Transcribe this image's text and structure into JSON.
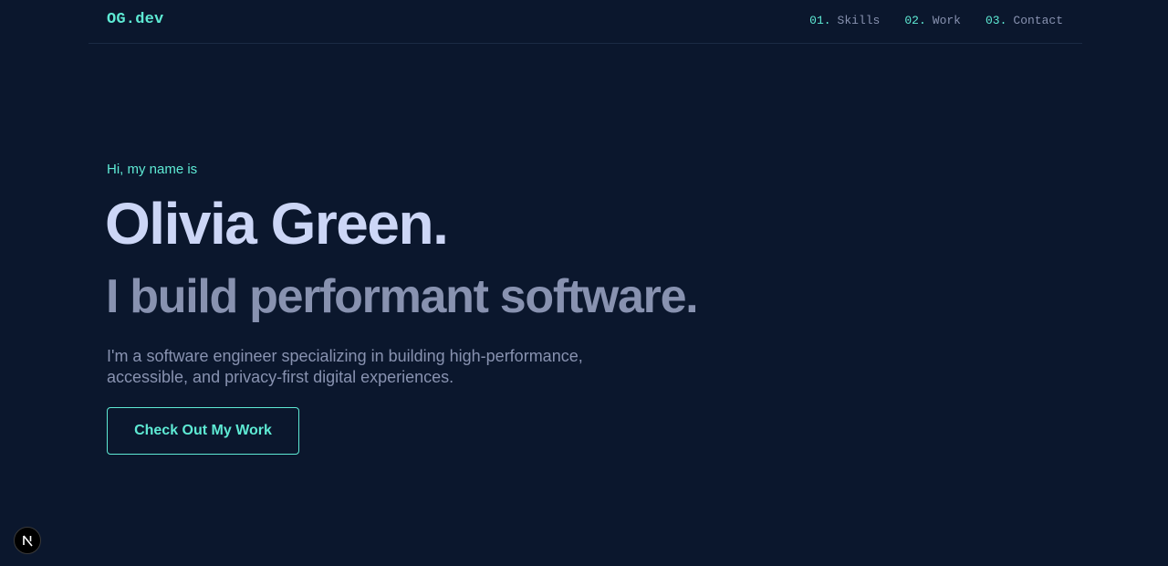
{
  "header": {
    "logo": "OG.dev",
    "nav": [
      {
        "num": "01.",
        "label": "Skills"
      },
      {
        "num": "02.",
        "label": "Work"
      },
      {
        "num": "03.",
        "label": "Contact"
      }
    ]
  },
  "hero": {
    "greeting": "Hi, my name is",
    "name": "Olivia Green.",
    "tagline": "I build performant software.",
    "description": "I'm a software engineer specializing in building high-performance, accessible, and privacy-first digital experiences.",
    "cta_label": "Check Out My Work"
  },
  "dev_badge": {
    "letter": "N",
    "icon": "nextjs-icon"
  },
  "colors": {
    "background": "#0b172d",
    "accent": "#5eead4",
    "heading": "#ccd6f6",
    "muted": "#8892b0"
  }
}
